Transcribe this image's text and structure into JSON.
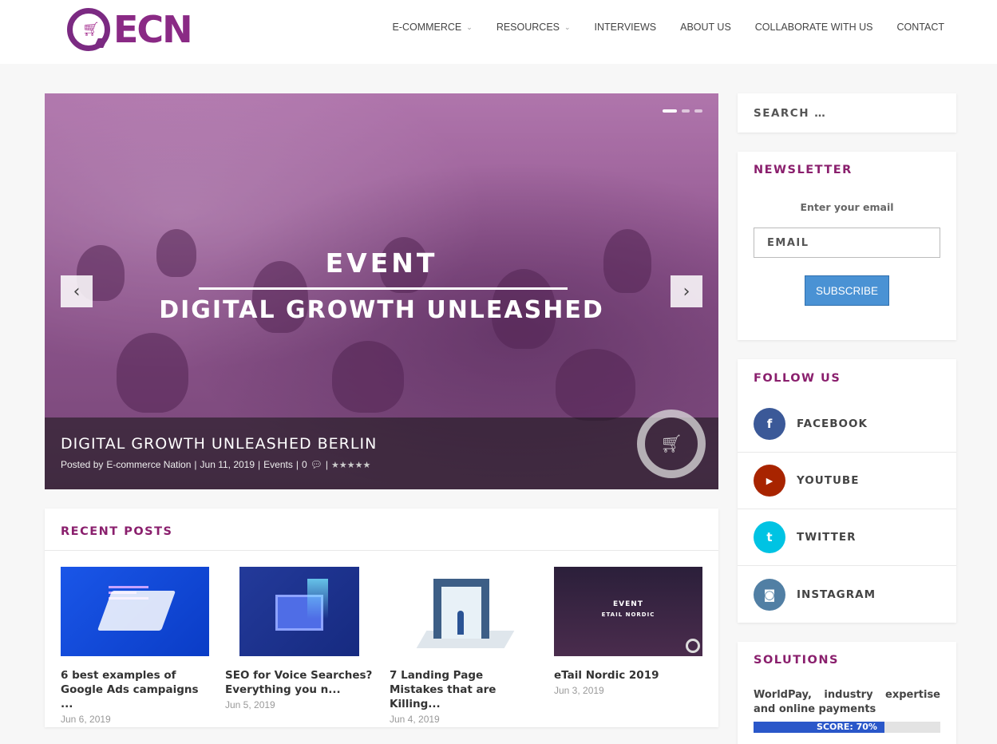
{
  "header": {
    "logo_text": "ECN",
    "nav": [
      {
        "label": "E-COMMERCE",
        "has_dropdown": true
      },
      {
        "label": "RESOURCES",
        "has_dropdown": true
      },
      {
        "label": "INTERVIEWS",
        "has_dropdown": false
      },
      {
        "label": "ABOUT US",
        "has_dropdown": false
      },
      {
        "label": "COLLABORATE WITH US",
        "has_dropdown": false
      },
      {
        "label": "CONTACT",
        "has_dropdown": false
      }
    ]
  },
  "slider": {
    "image_kicker": "EVENT",
    "image_headline": "DIGITAL GROWTH UNLEASHED",
    "title": "DIGITAL GROWTH UNLEASHED BERLIN",
    "meta": {
      "posted_by": "Posted by",
      "author": "E-commerce Nation",
      "date": "Jun 11, 2019",
      "category": "Events",
      "comments": "0"
    },
    "dots": 3,
    "active_dot": 0
  },
  "recent_posts": {
    "title": "RECENT POSTS",
    "items": [
      {
        "title": "6 best examples of Google Ads campaigns ...",
        "date": "Jun 6, 2019"
      },
      {
        "title": "SEO for Voice Searches? Everything you n...",
        "date": "Jun 5, 2019"
      },
      {
        "title": "7 Landing Page Mistakes that are Killing...",
        "date": "Jun 4, 2019"
      },
      {
        "title": "eTail Nordic 2019",
        "date": "Jun 3, 2019",
        "thumb_kicker": "EVENT",
        "thumb_sub": "ETAIL NORDIC"
      }
    ]
  },
  "search": {
    "placeholder": "SEARCH …"
  },
  "newsletter": {
    "title": "NEWSLETTER",
    "label": "Enter your email",
    "email_placeholder": "EMAIL",
    "button": "SUBSCRIBE"
  },
  "follow": {
    "title": "FOLLOW US",
    "items": [
      {
        "name": "FACEBOOK",
        "icon": "facebook-icon",
        "glyph": "f",
        "color": "#3b5998"
      },
      {
        "name": "YOUTUBE",
        "icon": "youtube-icon",
        "glyph": "▶",
        "color": "#a82400"
      },
      {
        "name": "TWITTER",
        "icon": "twitter-icon",
        "glyph": "t",
        "color": "#00c3e3"
      },
      {
        "name": "INSTAGRAM",
        "icon": "instagram-icon",
        "glyph": "◙",
        "color": "#517fa4"
      }
    ]
  },
  "solutions": {
    "title": "SOLUTIONS",
    "item_text": "WorldPay, industry expertise and online payments",
    "score_label": "SCORE: 70%",
    "score": 0.7
  },
  "colors": {
    "accent": "#8a1f6d",
    "button_blue": "#4a92d4",
    "score_blue": "#2a57c9"
  }
}
